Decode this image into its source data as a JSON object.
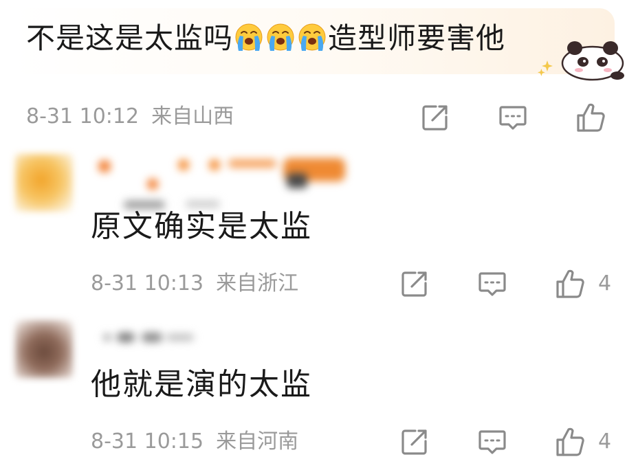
{
  "main_comment": {
    "text_before": "不是这是太监吗",
    "text_after": "造型师要害他",
    "emoji_icon": "crying-face-emoji",
    "time": "8-31 10:12",
    "location": "来自山西"
  },
  "replies": [
    {
      "text": "原文确实是太监",
      "time": "8-31 10:13",
      "location": "来自浙江",
      "likes": "4"
    },
    {
      "text": "他就是演的太监",
      "time": "8-31 10:15",
      "location": "来自河南",
      "likes": "4"
    }
  ],
  "icons": {
    "share": "share-edit-icon",
    "comment": "comment-bubble-icon",
    "like": "thumbs-up-icon"
  },
  "colors": {
    "meta_gray": "#9a9a9a",
    "icon_gray": "#8a8a8a",
    "text": "#1a1a1a"
  }
}
